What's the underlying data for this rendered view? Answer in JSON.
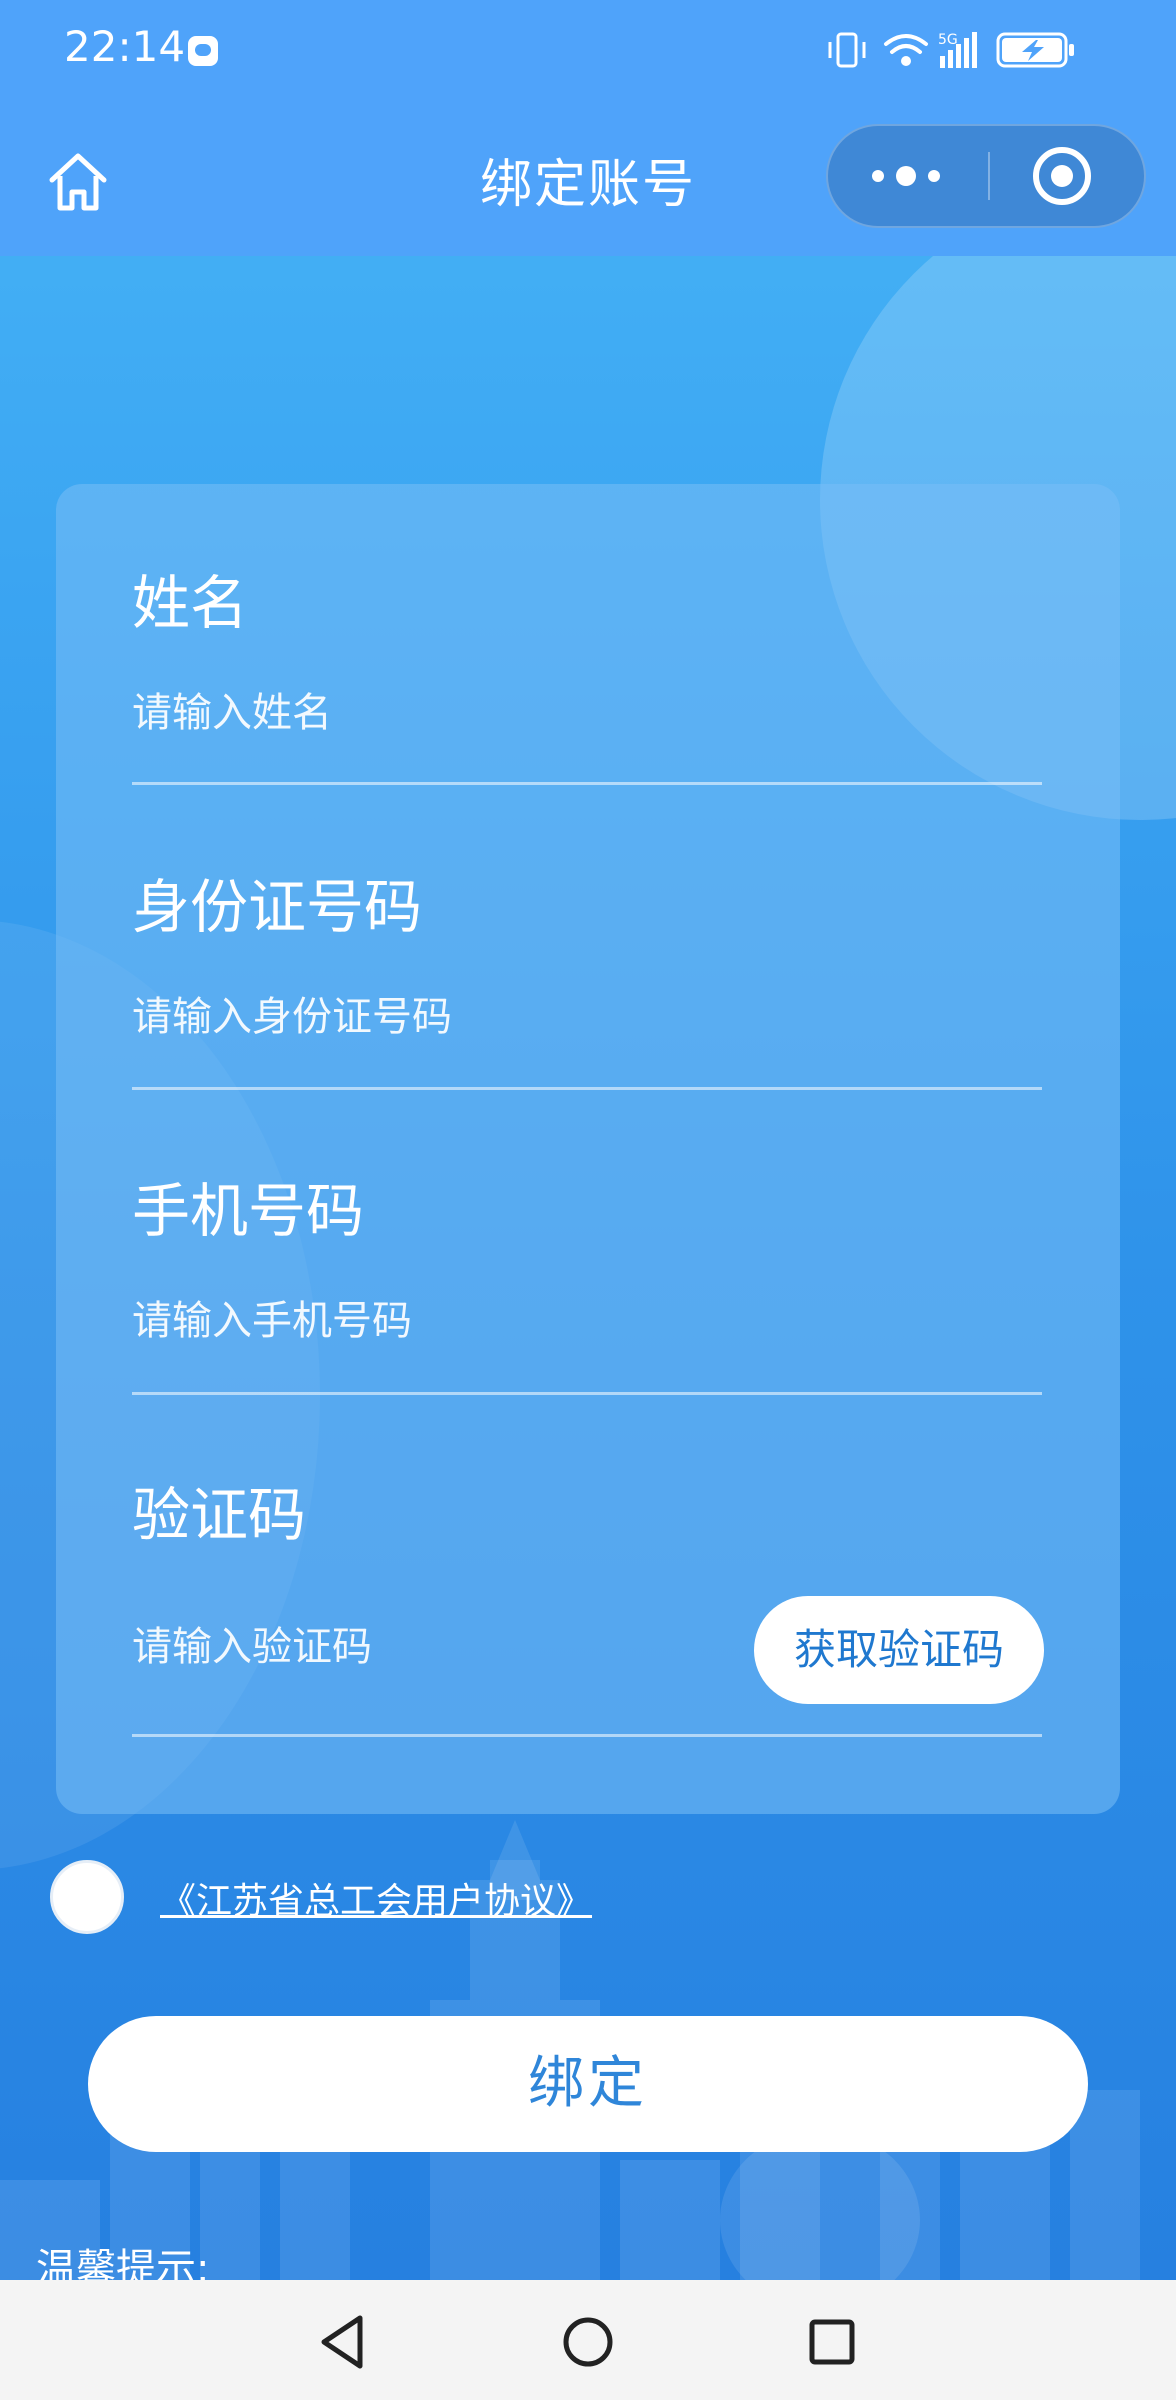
{
  "status_bar": {
    "time": "22:14",
    "network": "5G",
    "icons": [
      "message-icon",
      "vibrate-icon",
      "wifi-icon",
      "signal-icon",
      "battery-charging-icon"
    ]
  },
  "navbar": {
    "title": "绑定账号",
    "icons": [
      "home-icon",
      "more-icon",
      "target-icon"
    ]
  },
  "form": {
    "fields": [
      {
        "label": "姓名",
        "placeholder": "请输入姓名"
      },
      {
        "label": "身份证号码",
        "placeholder": "请输入身份证号码"
      },
      {
        "label": "手机号码",
        "placeholder": "请输入手机号码"
      },
      {
        "label": "验证码",
        "placeholder": "请输入验证码"
      }
    ],
    "get_code_button": "获取验证码"
  },
  "agreement": {
    "text": "《江苏省总工会用户协议》",
    "checked": false
  },
  "bind_button": "绑定",
  "tips_label": "温馨提示:",
  "system_nav": {
    "icons": [
      "back-icon",
      "home-circle-icon",
      "recents-icon"
    ]
  },
  "colors": {
    "header": "#4fa3fa",
    "background_top": "#48b6f6",
    "background_bottom": "#2680e0",
    "button_text": "#2f86d9"
  }
}
